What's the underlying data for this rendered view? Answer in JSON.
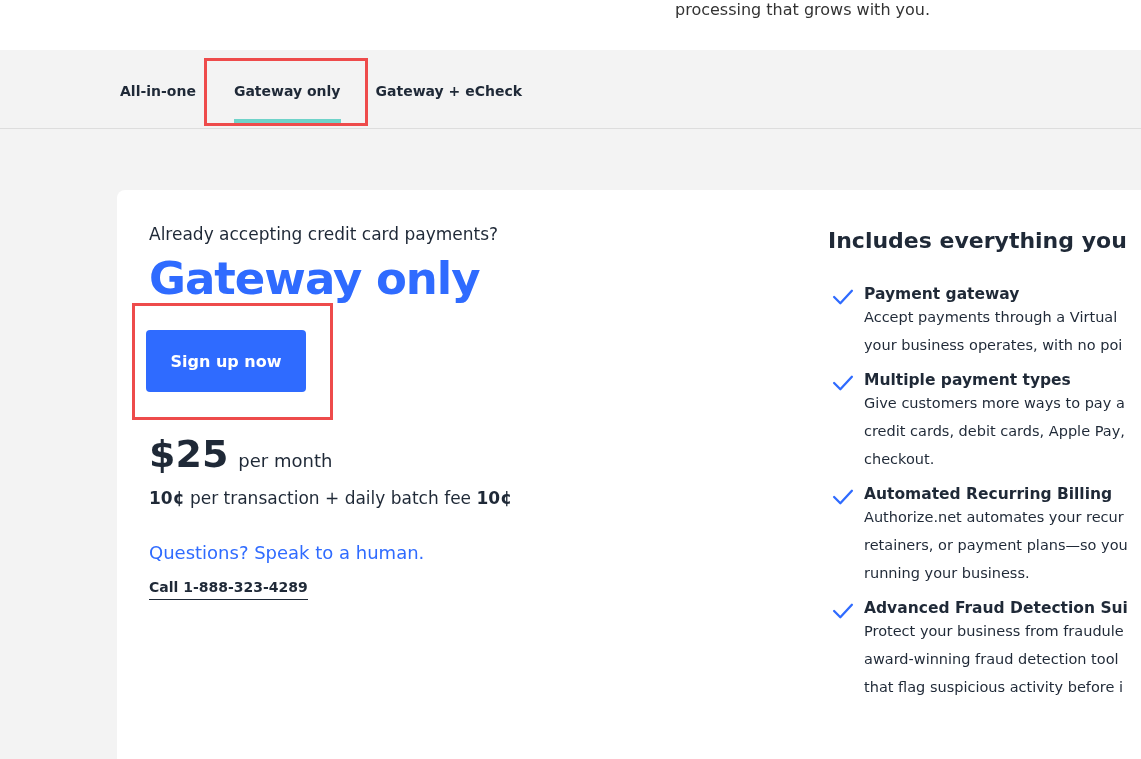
{
  "hero": {
    "tagline": "processing that grows with you."
  },
  "tabs": [
    {
      "label": "All-in-one",
      "selected": false,
      "highlighted": false
    },
    {
      "label": "Gateway only",
      "selected": true,
      "highlighted": true
    },
    {
      "label": "Gateway + eCheck",
      "selected": false,
      "highlighted": false
    }
  ],
  "plan": {
    "intro": "Already accepting credit card payments?",
    "title": "Gateway only",
    "button": {
      "label": "Sign up now",
      "highlighted": true
    },
    "price": "$25",
    "price_unit": "per month",
    "fees": "**10¢** per transaction + daily batch fee **10¢**",
    "questions_link": "Questions? Speak to a human.",
    "phone_link": "Call 1-888-323-4289"
  },
  "features": {
    "heading": "Includes everything you",
    "items": [
      {
        "title": "Payment gateway",
        "lines": [
          "Accept payments through a Virtual",
          "your business operates, with no poi"
        ]
      },
      {
        "title": "Multiple payment types",
        "lines": [
          "Give customers more ways to pay a",
          "credit cards, debit cards, Apple Pay,",
          "checkout."
        ]
      },
      {
        "title": "Automated Recurring Billing",
        "lines": [
          "Authorize.net automates your recur",
          "retainers, or payment plans—so you",
          "running your business."
        ]
      },
      {
        "title": "Advanced Fraud Detection Sui",
        "lines": [
          "Protect your business from fraudule",
          "award-winning fraud detection tool",
          "that flag suspicious activity before i"
        ]
      }
    ]
  }
}
